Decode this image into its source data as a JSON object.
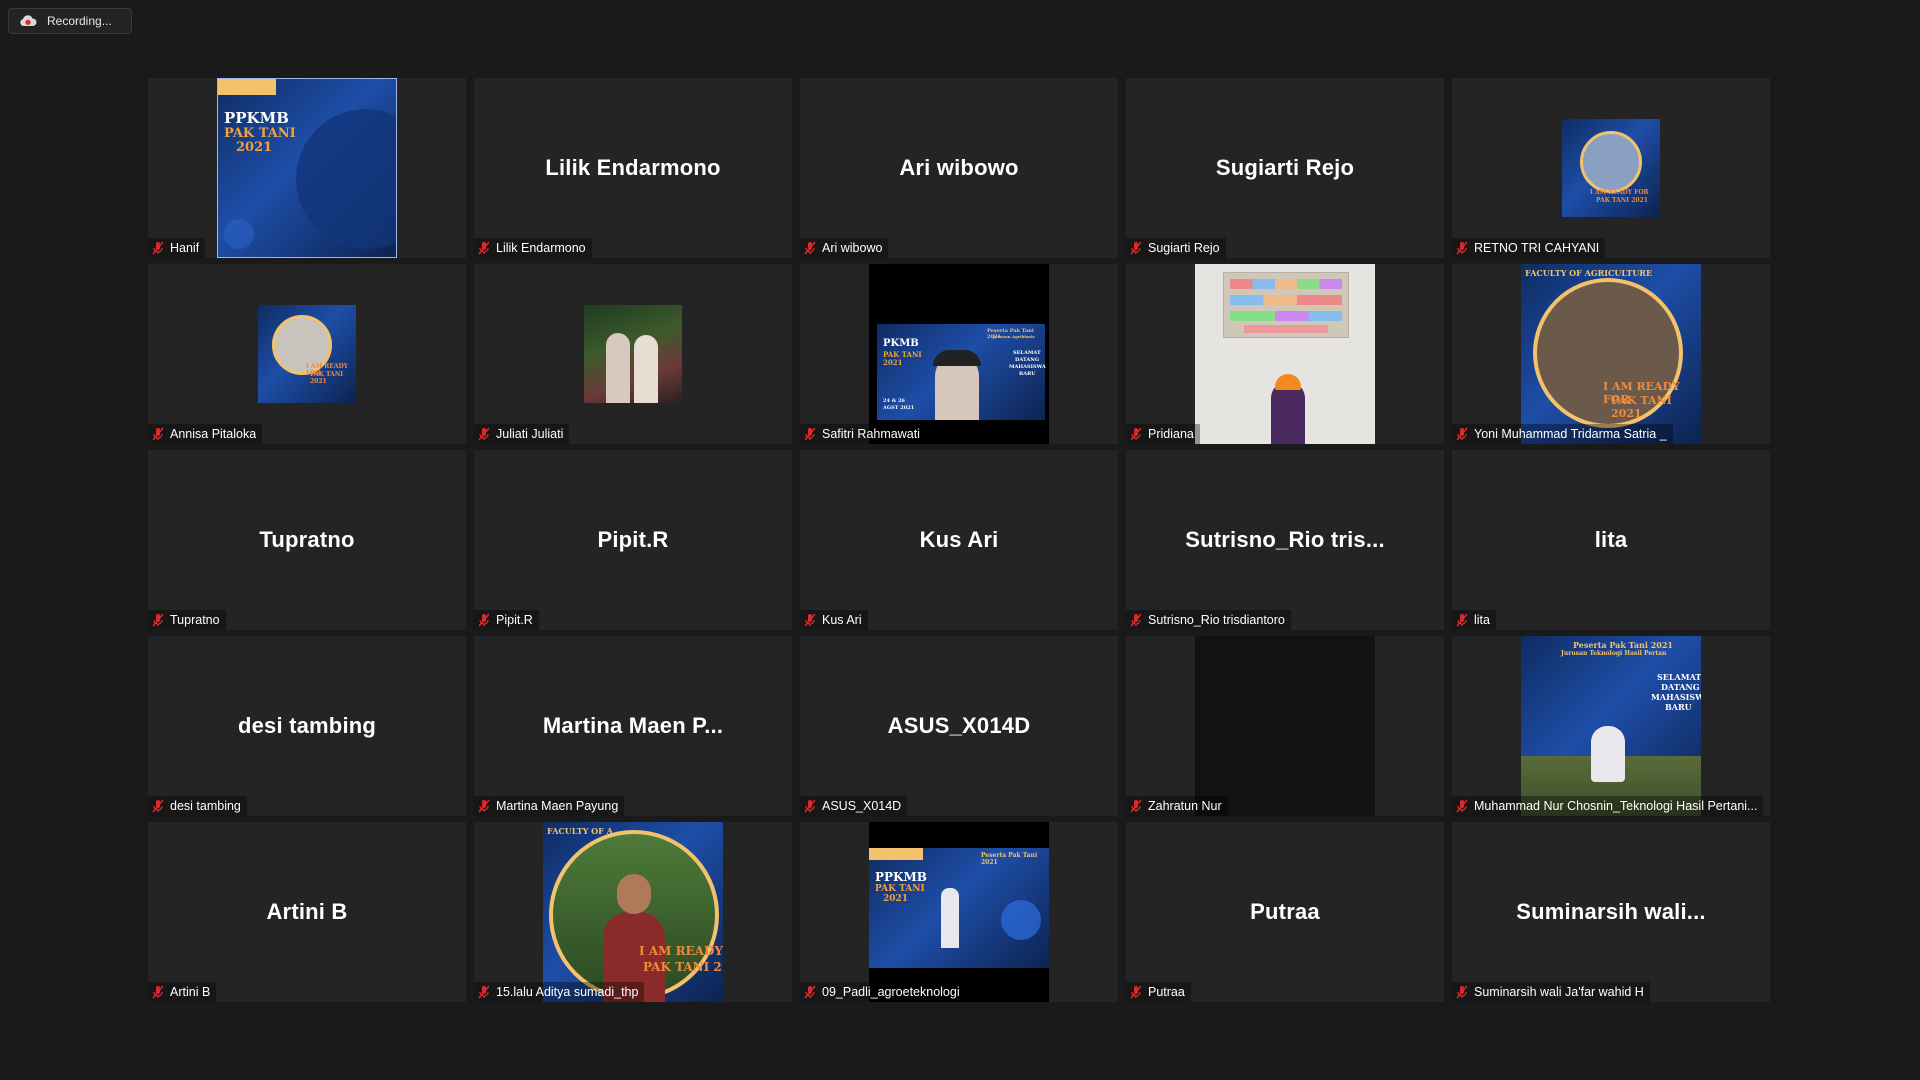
{
  "recording": {
    "label": "Recording..."
  },
  "colors": {
    "background": "#1a1a1a",
    "tile": "#242424",
    "mute_red": "#e02828",
    "accent_orange": "#f2a23a"
  },
  "participants": [
    {
      "display": "video",
      "name": "Hanif",
      "video_text": [
        "PPKMB",
        "PAK TANI",
        "2021"
      ]
    },
    {
      "display": "name",
      "name": "Lilik Endarmono",
      "center": "Lilik Endarmono"
    },
    {
      "display": "name",
      "name": "Ari wibowo",
      "center": "Ari wibowo"
    },
    {
      "display": "name",
      "name": "Sugiarti Rejo",
      "center": "Sugiarti Rejo"
    },
    {
      "display": "thumb",
      "name": "RETNO TRI CAHYANI",
      "video_text": [
        "I AM READY FOR",
        "PAK TANI 2021"
      ]
    },
    {
      "display": "thumb",
      "name": "Annisa Pitaloka",
      "video_text": [
        "I AM READY FOR",
        "PAK TANI 2021"
      ]
    },
    {
      "display": "thumb",
      "name": "Juliati Juliati"
    },
    {
      "display": "video",
      "name": "Safitri Rahmawati",
      "video_text": [
        "PKMB",
        "PAK TANI",
        "2021",
        "Peserta Pak Tani 2021",
        "Jurusan Agribisnis",
        "SELAMAT",
        "DATANG",
        "MAHASISWA",
        "BARU",
        "24 & 26",
        "AGST 2021"
      ]
    },
    {
      "display": "video",
      "name": "Pridiana"
    },
    {
      "display": "video",
      "name": "Yoni Muhammad Tridarma Satria _",
      "video_text": [
        "FACULTY OF AGRICULTURE",
        "I AM READY FOR",
        "PAK TANI 2021"
      ]
    },
    {
      "display": "name",
      "name": "Tupratno",
      "center": "Tupratno"
    },
    {
      "display": "name",
      "name": "Pipit.R",
      "center": "Pipit.R"
    },
    {
      "display": "name",
      "name": "Kus Ari",
      "center": "Kus Ari"
    },
    {
      "display": "name",
      "name": "Sutrisno_Rio trisdiantoro",
      "center": "Sutrisno_Rio  tris..."
    },
    {
      "display": "name",
      "name": "lita",
      "center": "lita"
    },
    {
      "display": "name",
      "name": "desi tambing",
      "center": "desi tambing"
    },
    {
      "display": "name",
      "name": "Martina Maen Payung",
      "center": "Martina Maen P..."
    },
    {
      "display": "name",
      "name": "ASUS_X014D",
      "center": "ASUS_X014D"
    },
    {
      "display": "video",
      "name": "Zahratun Nur"
    },
    {
      "display": "video",
      "name": "Muhammad Nur Chosnin_Teknologi Hasil Pertani...",
      "video_text": [
        "Peserta Pak Tani 2021",
        "Jurusan Teknologi Hasil Pertan",
        "SELAMAT",
        "DATANG",
        "MAHASISW",
        "BARU"
      ]
    },
    {
      "display": "name",
      "name": "Artini B",
      "center": "Artini B"
    },
    {
      "display": "video",
      "name": "15.lalu Aditya sumadi_thp",
      "video_text": [
        "FACULTY OF A",
        "I AM READY",
        "PAK TANI 2"
      ]
    },
    {
      "display": "video",
      "name": "09_Padli_agroeteknologi",
      "video_text": [
        "PPKMB",
        "PAK TANI",
        "2021",
        "Peserta Pak Tani 2021"
      ]
    },
    {
      "display": "name",
      "name": "Putraa",
      "center": "Putraa"
    },
    {
      "display": "name",
      "name": "Suminarsih wali Ja'far wahid H",
      "center": "Suminarsih  wali..."
    }
  ]
}
